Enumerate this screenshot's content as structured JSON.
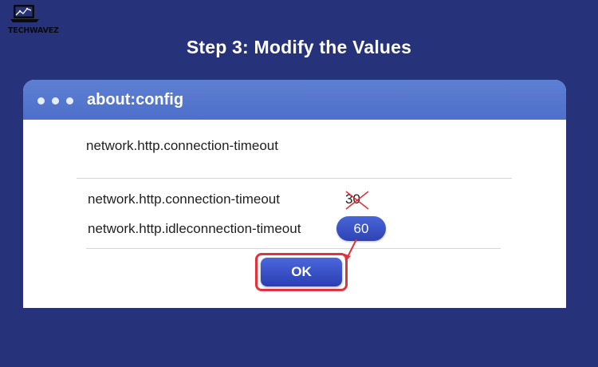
{
  "logo": {
    "text": "TECHWAVEZ",
    "icon": "laptop-chart-icon"
  },
  "heading": "Step 3: Modify the Values",
  "window": {
    "title": "about:config",
    "controls": [
      "window-dot",
      "window-dot",
      "window-dot"
    ]
  },
  "preferences": {
    "top_entry": "network.http.connection-timeout",
    "entries": [
      {
        "name": "network.http.connection-timeout",
        "old_value": "30"
      },
      {
        "name": "network.http.idleconnection-timeout",
        "new_value": "60"
      }
    ]
  },
  "ok_button": {
    "label": "OK"
  },
  "colors": {
    "background": "#26327a",
    "titlebar": "#5877cf",
    "accent": "#2f47bb",
    "highlight": "#e0343c"
  }
}
